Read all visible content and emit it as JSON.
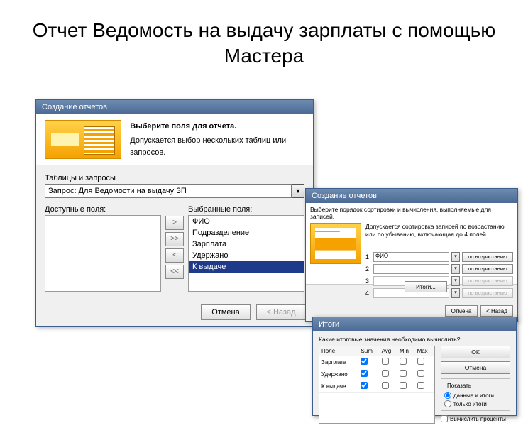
{
  "slide": {
    "title": "Отчет Ведомость на выдачу зарплаты с помощью Мастера"
  },
  "dlg1": {
    "title": "Создание отчетов",
    "hero_h": "Выберите поля для отчета.",
    "hero_s": "Допускается выбор нескольких таблиц или запросов.",
    "tbl_lbl": "Таблицы и запросы",
    "combo_val": "Запрос: Для Ведомости на выдачу ЗП",
    "avail_lbl": "Доступные поля:",
    "sel_lbl": "Выбранные поля:",
    "mover": {
      "r": ">",
      "rr": ">>",
      "l": "<",
      "ll": "<<"
    },
    "selected": [
      "ФИО",
      "Подразделение",
      "Зарплата",
      "Удержано",
      "К выдаче"
    ],
    "btn_cancel": "Отмена",
    "btn_back": "< Назад"
  },
  "dlg2": {
    "title": "Создание отчетов",
    "line1": "Выберите порядок сортировки и вычисления, выполняемые для записей.",
    "line2": "Допускается сортировка записей по возрастанию или по убыванию, включающая до 4 полей.",
    "rows": [
      {
        "n": "1",
        "field": "ФИО",
        "dir": "по возрастанию",
        "enabled": true
      },
      {
        "n": "2",
        "field": "",
        "dir": "по возрастанию",
        "enabled": true
      },
      {
        "n": "3",
        "field": "",
        "dir": "по возрастанию",
        "enabled": false
      },
      {
        "n": "4",
        "field": "",
        "dir": "по возрастанию",
        "enabled": false
      }
    ],
    "itogi": "Итоги..."
  },
  "dlg3": {
    "title": "Итоги",
    "question": "Какие итоговые значения необходимо вычислить?",
    "headers": {
      "field": "Поле",
      "sum": "Sum",
      "avg": "Avg",
      "min": "Min",
      "max": "Max"
    },
    "rows": [
      {
        "f": "Зарплата",
        "sum": true,
        "avg": false,
        "min": false,
        "max": false
      },
      {
        "f": "Удержано",
        "sum": true,
        "avg": false,
        "min": false,
        "max": false
      },
      {
        "f": "К выдаче",
        "sum": true,
        "avg": false,
        "min": false,
        "max": false
      }
    ],
    "ok": "ОК",
    "cancel": "Отмена",
    "grp_title": "Показать",
    "radio_detail": "данные и итоги",
    "radio_totals": "только итоги",
    "chk_percent": "Вычислить проценты"
  }
}
